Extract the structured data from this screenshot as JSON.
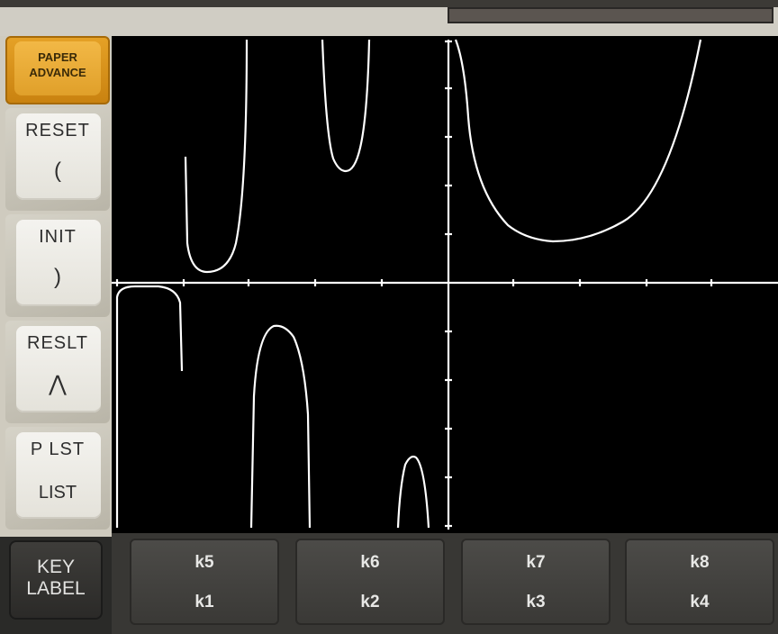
{
  "left_keys": {
    "paper_advance": "PAPER ADVANCE",
    "reset": {
      "top": "RESET",
      "bottom": "("
    },
    "init": {
      "top": "INIT",
      "bottom": ")"
    },
    "reslt": {
      "top": "RESLT",
      "bottom": "⋀"
    },
    "plst": {
      "top": "P LST",
      "bottom": "LIST"
    },
    "key_label": {
      "line1": "KEY",
      "line2": "LABEL"
    }
  },
  "softkeys": [
    {
      "upper": "k5",
      "lower": "k1"
    },
    {
      "upper": "k6",
      "lower": "k2"
    },
    {
      "upper": "k7",
      "lower": "k3"
    },
    {
      "upper": "k8",
      "lower": "k4"
    }
  ],
  "colors": {
    "screen": "#000000",
    "trace": "#ffffff",
    "paper_key": "#e0a02a"
  }
}
